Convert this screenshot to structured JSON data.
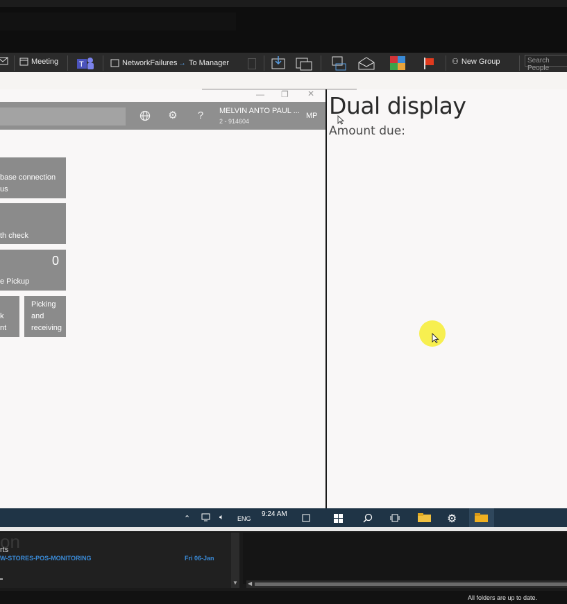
{
  "ribbon": {
    "meeting": "Meeting",
    "network_failures": "NetworkFailures",
    "to_manager": "To Manager",
    "new_group": "New Group",
    "search_people_placeholder": "Search People"
  },
  "pos": {
    "user_name": "MELVIN ANTO PAUL ...",
    "user_id": "2 - 914604",
    "initials": "MP",
    "tiles": {
      "db_line1": "base connection",
      "db_line2": "us",
      "health": "th check",
      "pickup_label": "e Pickup",
      "pickup_count": "0",
      "k_line1": "k",
      "k_line2": "nt",
      "picking": "Picking\nand\nreceiving"
    }
  },
  "dual_display": {
    "title": "Dual display",
    "amount_label": "Amount due:"
  },
  "taskbar": {
    "time": "9:24 AM",
    "language": "ENG"
  },
  "outlook_bottom": {
    "partial_heading": "on",
    "folder_label": "rts",
    "message_sender": "W-STORES-POS-MONITORING",
    "message_date": "Fri 06-Jan",
    "status": "All folders are up to date."
  },
  "colors": {
    "tile": "#8b8b8b",
    "header": "#8f8f8f",
    "taskbar": "#1f3446",
    "cursor_highlight": "#f7ef50",
    "link_blue": "#3a8ad6"
  }
}
